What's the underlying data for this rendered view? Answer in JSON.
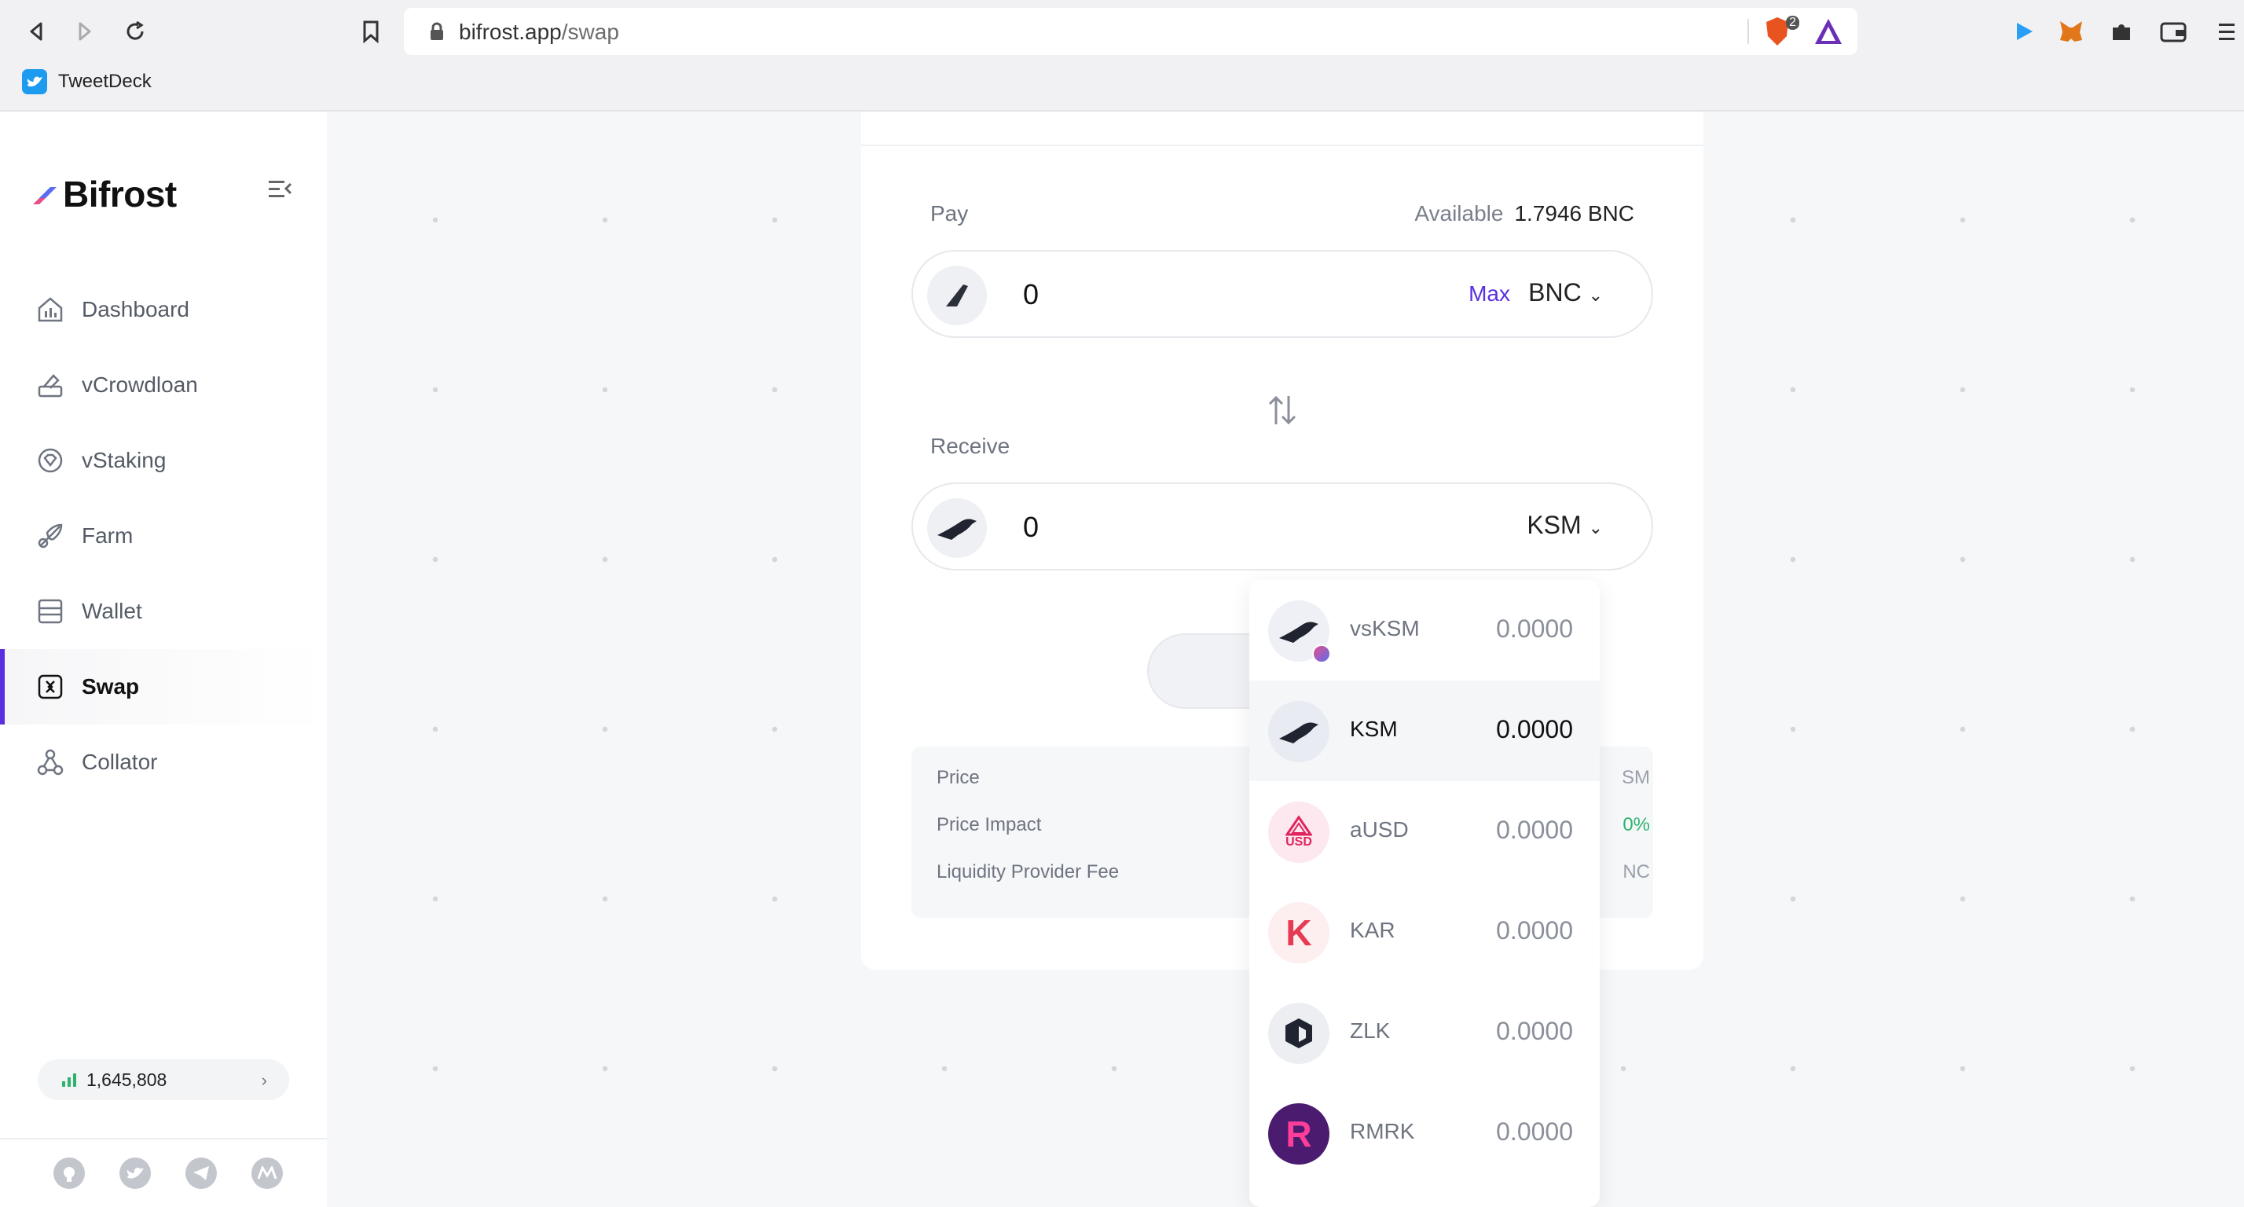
{
  "browser": {
    "url_host": "bifrost.app",
    "url_path": "/swap",
    "bookmark": "TweetDeck",
    "brave_badge": "2"
  },
  "sidebar": {
    "brand": "Bifrost",
    "items": [
      {
        "label": "Dashboard",
        "icon": "dashboard-icon"
      },
      {
        "label": "vCrowdloan",
        "icon": "crowdloan-icon"
      },
      {
        "label": "vStaking",
        "icon": "staking-icon"
      },
      {
        "label": "Farm",
        "icon": "farm-icon"
      },
      {
        "label": "Wallet",
        "icon": "wallet-icon"
      },
      {
        "label": "Swap",
        "icon": "swap-icon",
        "active": true
      },
      {
        "label": "Collator",
        "icon": "collator-icon"
      }
    ],
    "block_number": "1,645,808",
    "social": [
      "github-icon",
      "twitter-icon",
      "telegram-icon",
      "medium-icon"
    ]
  },
  "swap": {
    "pay_label": "Pay",
    "available_label": "Available",
    "available_value": "1.7946 BNC",
    "pay_amount": "0",
    "max_label": "Max",
    "pay_token": "BNC",
    "receive_label": "Receive",
    "receive_amount": "0",
    "receive_token": "KSM"
  },
  "info": {
    "rows": [
      {
        "label": "Price",
        "value": "SM"
      },
      {
        "label": "Price Impact",
        "value": "0%"
      },
      {
        "label": "Liquidity Provider Fee",
        "value": "NC"
      }
    ]
  },
  "token_dropdown": [
    {
      "symbol": "vsKSM",
      "balance": "0.0000",
      "icon": "vsksm-icon"
    },
    {
      "symbol": "KSM",
      "balance": "0.0000",
      "icon": "ksm-icon",
      "selected": true
    },
    {
      "symbol": "aUSD",
      "balance": "0.0000",
      "icon": "ausd-icon",
      "icon_text": "USD"
    },
    {
      "symbol": "KAR",
      "balance": "0.0000",
      "icon": "kar-icon",
      "icon_text": "K"
    },
    {
      "symbol": "ZLK",
      "balance": "0.0000",
      "icon": "zlk-icon"
    },
    {
      "symbol": "RMRK",
      "balance": "0.0000",
      "icon": "rmrk-icon",
      "icon_text": "R"
    }
  ],
  "colors": {
    "accent": "#5a2fe0",
    "green": "#2db36b",
    "background": "#f6f7f9"
  }
}
